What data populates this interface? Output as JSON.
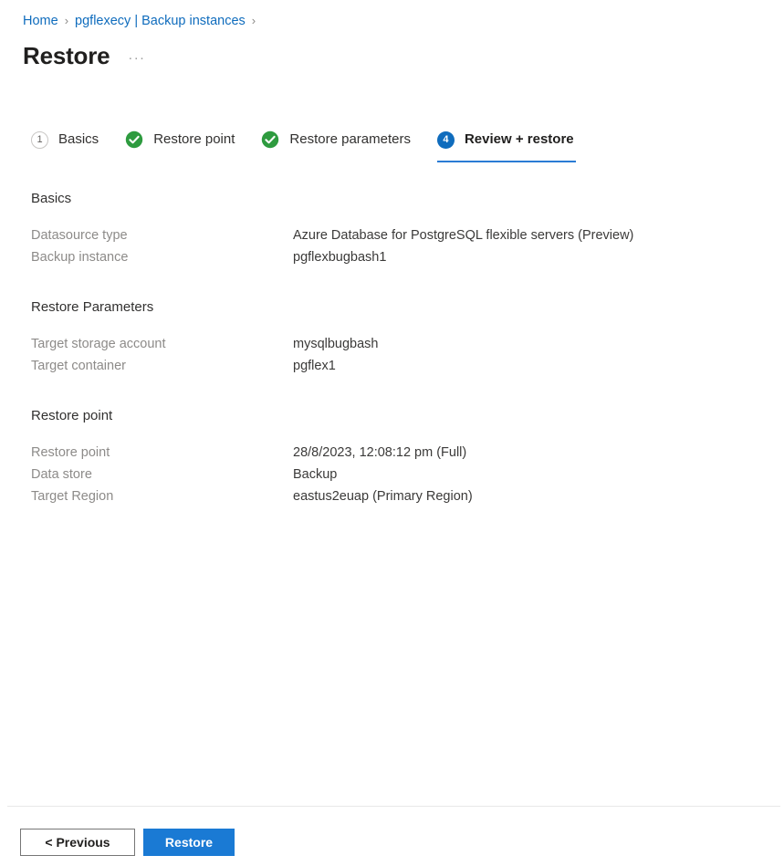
{
  "breadcrumb": {
    "separator": "›",
    "items": [
      {
        "label": "Home"
      },
      {
        "label": "pgflexecy | Backup instances"
      }
    ],
    "trailing_separator": "›"
  },
  "header": {
    "title": "Restore",
    "more_menu": "···"
  },
  "wizard": {
    "tabs": [
      {
        "label": "Basics",
        "badge": "1",
        "state": "pending",
        "icon": "circle-number-icon"
      },
      {
        "label": "Restore point",
        "badge": "",
        "state": "done",
        "icon": "check-circle-icon"
      },
      {
        "label": "Restore parameters",
        "badge": "",
        "state": "done",
        "icon": "check-circle-icon"
      },
      {
        "label": "Review + restore",
        "badge": "4",
        "state": "active",
        "icon": "circle-number-icon"
      }
    ]
  },
  "sections": [
    {
      "title": "Basics",
      "rows": [
        {
          "label": "Datasource type",
          "value": "Azure Database for PostgreSQL flexible servers (Preview)"
        },
        {
          "label": "Backup instance",
          "value": "pgflexbugbash1"
        }
      ]
    },
    {
      "title": "Restore Parameters",
      "rows": [
        {
          "label": "Target storage account",
          "value": "mysqlbugbash"
        },
        {
          "label": "Target container",
          "value": "pgflex1"
        }
      ]
    },
    {
      "title": "Restore point",
      "rows": [
        {
          "label": "Restore point",
          "value": "28/8/2023, 12:08:12 pm (Full)"
        },
        {
          "label": "Data store",
          "value": "Backup"
        },
        {
          "label": "Target Region",
          "value": "eastus2euap (Primary Region)"
        }
      ]
    }
  ],
  "footer": {
    "previous_label": "< Previous",
    "restore_label": "Restore"
  },
  "colors": {
    "accent_blue": "#0f6cbd",
    "primary_button": "#1a7ad4",
    "success_green": "#2e9b3f",
    "link": "#0f6cbd",
    "label_gray": "#8d8b89",
    "value_gray": "#3b3a39"
  }
}
